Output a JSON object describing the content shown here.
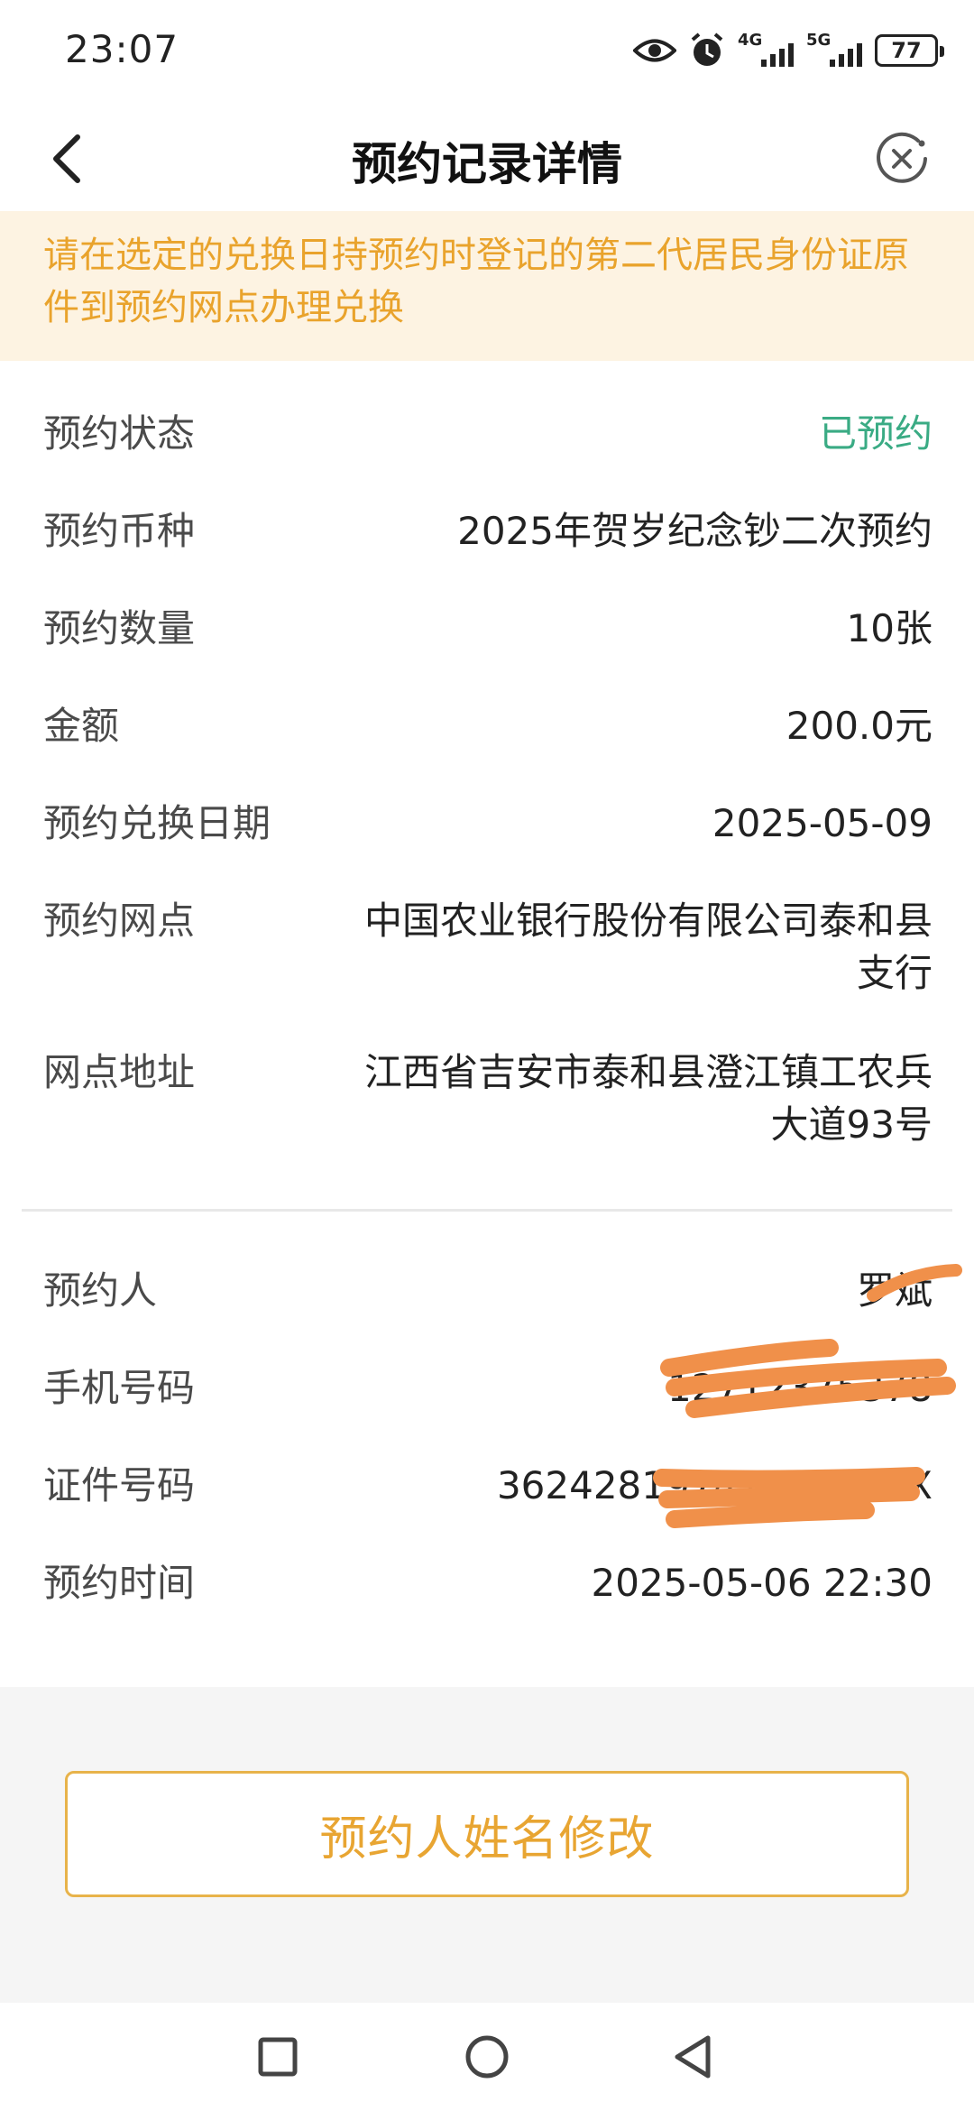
{
  "status_bar": {
    "time": "23:07",
    "network_1": "4G",
    "network_2": "5G",
    "battery": "77",
    "icons": [
      "eye-icon",
      "alarm-icon",
      "signal-4g-icon",
      "signal-5g-icon",
      "battery-icon"
    ]
  },
  "nav": {
    "title": "预约记录详情",
    "back_icon": "chevron-left-icon",
    "close_icon": "close-circle-icon"
  },
  "notice": {
    "text": "请在选定的兑换日持预约时登记的第二代居民身份证原件到预约网点办理兑换"
  },
  "details": {
    "status": {
      "label": "预约状态",
      "value": "已预约"
    },
    "currency": {
      "label": "预约币种",
      "value": "2025年贺岁纪念钞二次预约"
    },
    "quantity": {
      "label": "预约数量",
      "value": "10张"
    },
    "amount": {
      "label": "金额",
      "value": "200.0元"
    },
    "date": {
      "label": "预约兑换日期",
      "value": "2025-05-09"
    },
    "branch": {
      "label": "预约网点",
      "value": "中国农业银行股份有限公司泰和县支行"
    },
    "address": {
      "label": "网点地址",
      "value": "江西省吉安市泰和县澄江镇工农兵大道93号"
    }
  },
  "person": {
    "name": {
      "label": "预约人",
      "value": "罗斌"
    },
    "phone": {
      "label": "手机号码",
      "value": "12712375378"
    },
    "id": {
      "label": "证件号码",
      "value": "36242819741201011X"
    },
    "time": {
      "label": "预约时间",
      "value": "2025-05-06 22:30"
    }
  },
  "actions": {
    "edit_name": "预约人姓名修改"
  },
  "colors": {
    "accent": "#e8a532",
    "notice_bg": "#fdf3e2",
    "status_green": "#3aab84",
    "redaction": "#f0904a"
  },
  "system_nav": [
    "square-icon",
    "circle-icon",
    "triangle-back-icon"
  ]
}
